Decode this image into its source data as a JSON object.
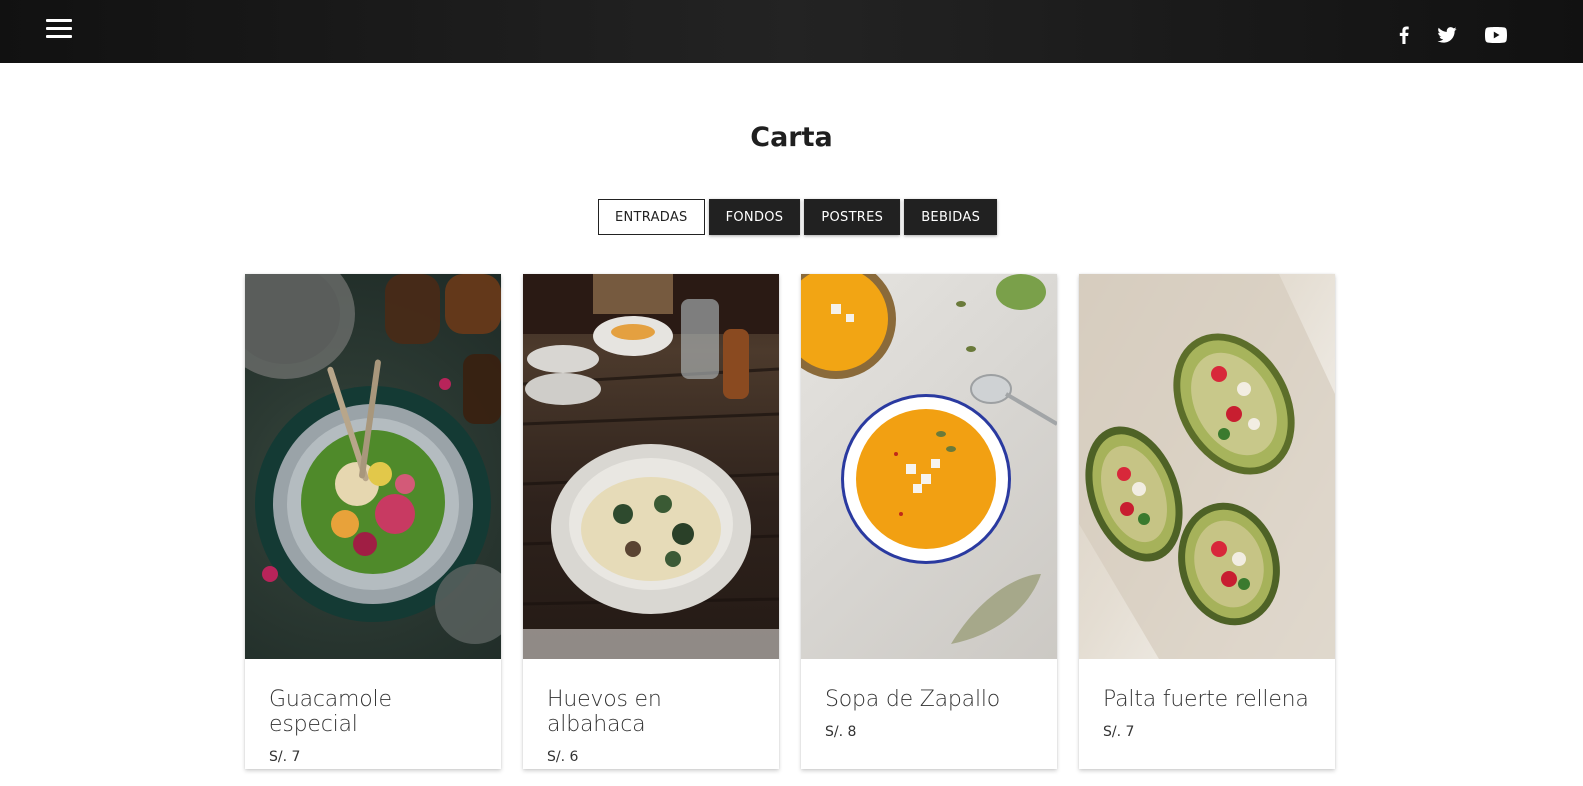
{
  "header": {
    "menu_icon": "hamburger-icon",
    "social_icons": [
      "facebook-icon",
      "twitter-icon",
      "youtube-icon"
    ]
  },
  "page": {
    "title": "Carta"
  },
  "tabs": [
    {
      "label": "ENTRADAS",
      "active": true
    },
    {
      "label": "FONDOS",
      "active": false
    },
    {
      "label": "POSTRES",
      "active": false
    },
    {
      "label": "BEBIDAS",
      "active": false
    }
  ],
  "menu_items": [
    {
      "name": "Guacamole especial",
      "price": "S/. 7"
    },
    {
      "name": "Huevos en albahaca",
      "price": "S/. 6"
    },
    {
      "name": "Sopa de Zapallo",
      "price": "S/. 8"
    },
    {
      "name": "Palta fuerte rellena",
      "price": "S/. 7"
    }
  ],
  "colors": {
    "topbar": "#1a1a1a",
    "tab_dark": "#212121",
    "tab_active_bg": "#ffffff",
    "text": "#222222"
  }
}
